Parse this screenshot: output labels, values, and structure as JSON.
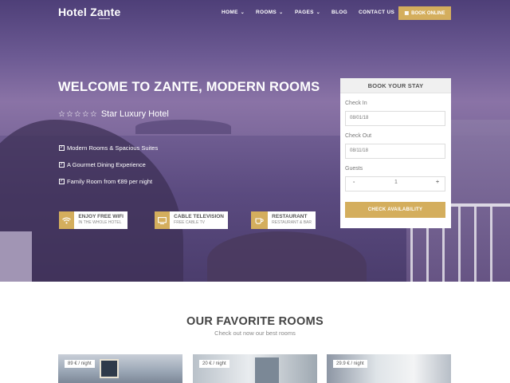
{
  "nav": {
    "logo": "Hotel Zante",
    "items": [
      {
        "label": "HOME",
        "has_dropdown": true
      },
      {
        "label": "ROOMS",
        "has_dropdown": true
      },
      {
        "label": "PAGES",
        "has_dropdown": true
      },
      {
        "label": "BLOG",
        "has_dropdown": false
      },
      {
        "label": "CONTACT US",
        "has_dropdown": false
      }
    ],
    "book_online": "BOOK ONLINE",
    "book_icon": "calendar-icon"
  },
  "hero": {
    "title": "WELCOME TO ZANTE, MODERN ROOMS",
    "stars": "☆☆☆☆☆",
    "rating_label": "Star Luxury Hotel",
    "features": [
      "Modern Rooms & Spacious Suites",
      "A Gourmet Dining Experience",
      "Family Room from €89 per night"
    ],
    "amenities": [
      {
        "icon": "wifi-icon",
        "title": "ENJOY FREE WIFI",
        "subtitle": "IN THE WHOLE HOTEL"
      },
      {
        "icon": "tv-icon",
        "title": "CABLE TELEVISION",
        "subtitle": "FREE CABLE TV"
      },
      {
        "icon": "coffee-icon",
        "title": "RESTAURANT",
        "subtitle": "RESTAURANT & BAR"
      }
    ]
  },
  "booking": {
    "title": "BOOK YOUR STAY",
    "check_in_label": "Check In",
    "check_in_value": "08/01/18",
    "check_out_label": "Check Out",
    "check_out_value": "08/11/18",
    "guests_label": "Guests",
    "guests_value": "1",
    "decrement": "-",
    "increment": "+",
    "submit": "CHECK AVAILABILITY"
  },
  "rooms": {
    "title": "OUR FAVORITE ROOMS",
    "subtitle": "Check out now our best rooms",
    "cards": [
      {
        "price": "89 € / night"
      },
      {
        "price": "20 € / night"
      },
      {
        "price": "29.9 € / night"
      }
    ]
  },
  "colors": {
    "accent": "#d4ae5d",
    "hero_overlay": "#6c5a93"
  }
}
